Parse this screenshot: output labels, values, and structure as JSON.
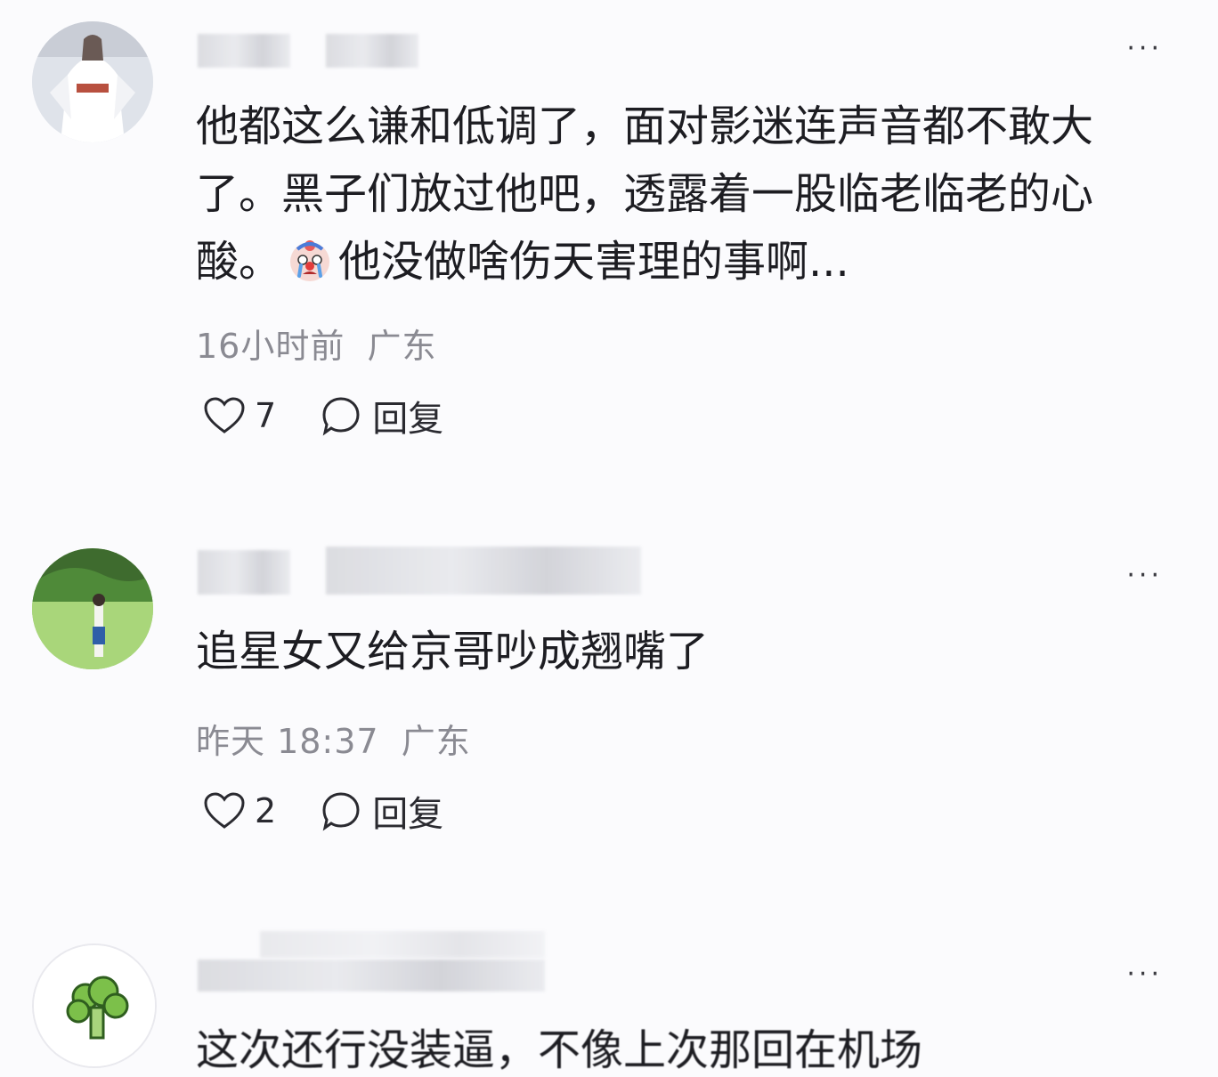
{
  "comments": [
    {
      "text_before_emoji": "他都这么谦和低调了，面对影迷连声音都不敢大了。黑子们放过他吧，透露着一股临老临老的心酸。",
      "emoji": "crying-clown-emoji",
      "text_after_emoji": "他没做啥伤天害理的事啊...",
      "time": "16小时前",
      "location": "广东",
      "likes": "7",
      "reply_label": "回复"
    },
    {
      "text": "追星女又给京哥吵成翘嘴了",
      "time": "昨天 18:37",
      "location": "广东",
      "likes": "2",
      "reply_label": "回复"
    },
    {
      "text_partial": "这次还行没装逼，不像上次那回在机场"
    }
  ],
  "more_icon": "···",
  "colors": {
    "background": "#fbfbfd",
    "text": "#1d1d22",
    "meta": "#8a8a92"
  }
}
